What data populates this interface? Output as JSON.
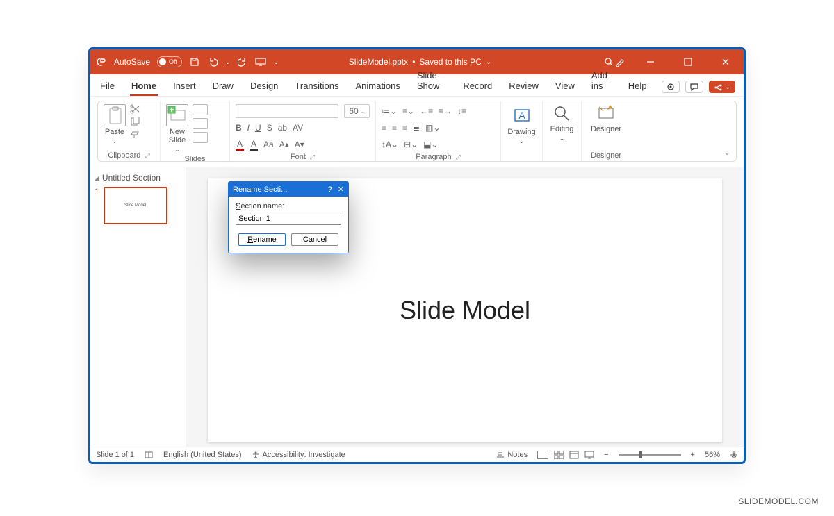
{
  "titlebar": {
    "autosave_label": "AutoSave",
    "autosave_state": "Off",
    "doc_title": "SlideModel.pptx",
    "save_state": "Saved to this PC"
  },
  "tabs": {
    "items": [
      "File",
      "Home",
      "Insert",
      "Draw",
      "Design",
      "Transitions",
      "Animations",
      "Slide Show",
      "Record",
      "Review",
      "View",
      "Add-ins",
      "Help"
    ],
    "active_index": 1
  },
  "ribbon": {
    "clipboard": {
      "paste": "Paste",
      "label": "Clipboard"
    },
    "slides": {
      "new_slide": "New\nSlide",
      "label": "Slides"
    },
    "font": {
      "label": "Font",
      "size_placeholder": "60",
      "row1": [
        "B",
        "I",
        "U",
        "S",
        "ab",
        "AV"
      ],
      "row2": [
        "A",
        "A",
        "Aa",
        "A▴",
        "A▾"
      ]
    },
    "paragraph": {
      "label": "Paragraph"
    },
    "drawing": {
      "btn": "Drawing",
      "label": ""
    },
    "editing": {
      "btn": "Editing"
    },
    "designer": {
      "btn": "Designer",
      "label": "Designer"
    }
  },
  "slidepanel": {
    "section_name": "Untitled Section",
    "thumb_number": "1",
    "thumb_text": "Slide Model"
  },
  "slide": {
    "title_text": "Slide Model"
  },
  "dialog": {
    "title": "Rename Secti...",
    "field_label": "Section name:",
    "input_value": "Section 1",
    "rename": "Rename",
    "cancel": "Cancel"
  },
  "status": {
    "slide_pos": "Slide 1 of 1",
    "language": "English (United States)",
    "accessibility": "Accessibility: Investigate",
    "notes": "Notes",
    "zoom": "56%"
  },
  "watermark": "SLIDEMODEL.COM"
}
